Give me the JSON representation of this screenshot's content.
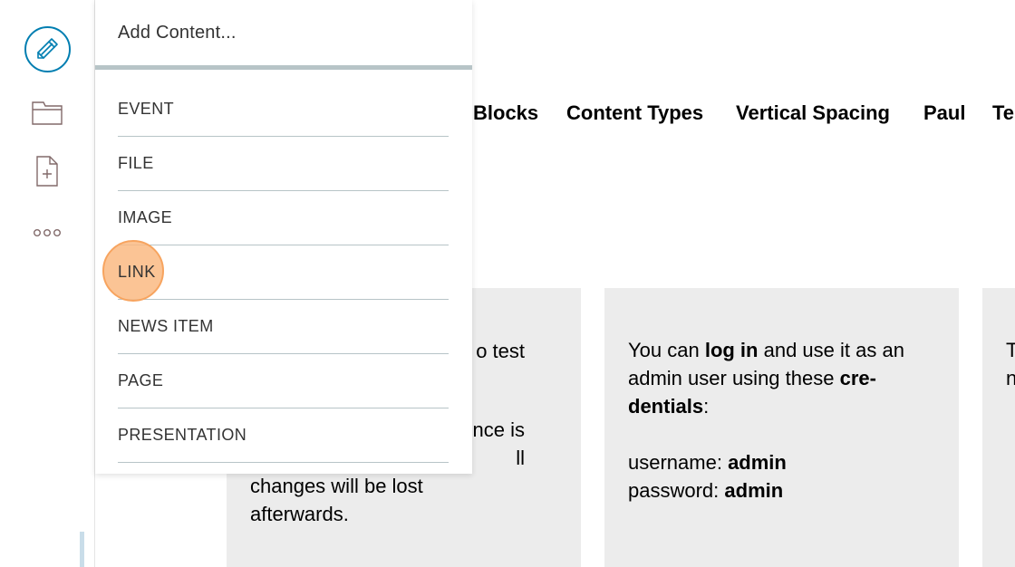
{
  "toolbar": {
    "buttons": [
      {
        "name": "edit",
        "icon": "pencil-icon"
      },
      {
        "name": "contents",
        "icon": "folder-icon"
      },
      {
        "name": "add",
        "icon": "add-document-icon"
      },
      {
        "name": "more",
        "icon": "more-dots-icon"
      }
    ],
    "accent_color": "#007eb1"
  },
  "nav": {
    "items": [
      "Blocks",
      "Content Types",
      "Vertical Spacing",
      "Paul",
      "Te"
    ]
  },
  "cards": {
    "card1": {
      "line_a": "o test",
      "line_b1": "nce is",
      "line_b2": "ll",
      "line_c1": "changes will be lost",
      "line_c2": "afterwards."
    },
    "card2": {
      "text_1": "You can ",
      "bold_1": "log in",
      "text_2": " and use it as an admin user using these ",
      "bold_2": "cre-dentials",
      "text_3": ":",
      "username_label": "username: ",
      "username_value": "admin",
      "password_label": "password: ",
      "password_value": "admin"
    },
    "card3": {
      "line_a": "T",
      "line_b": "n"
    },
    "background_color": "#ececec"
  },
  "menu": {
    "header": "Add Content...",
    "items": [
      "EVENT",
      "FILE",
      "IMAGE",
      "LINK",
      "NEWS ITEM",
      "PAGE",
      "PRESENTATION"
    ],
    "separator_color": "#b7c4c7"
  },
  "click_marker_color": "#f7a45f"
}
